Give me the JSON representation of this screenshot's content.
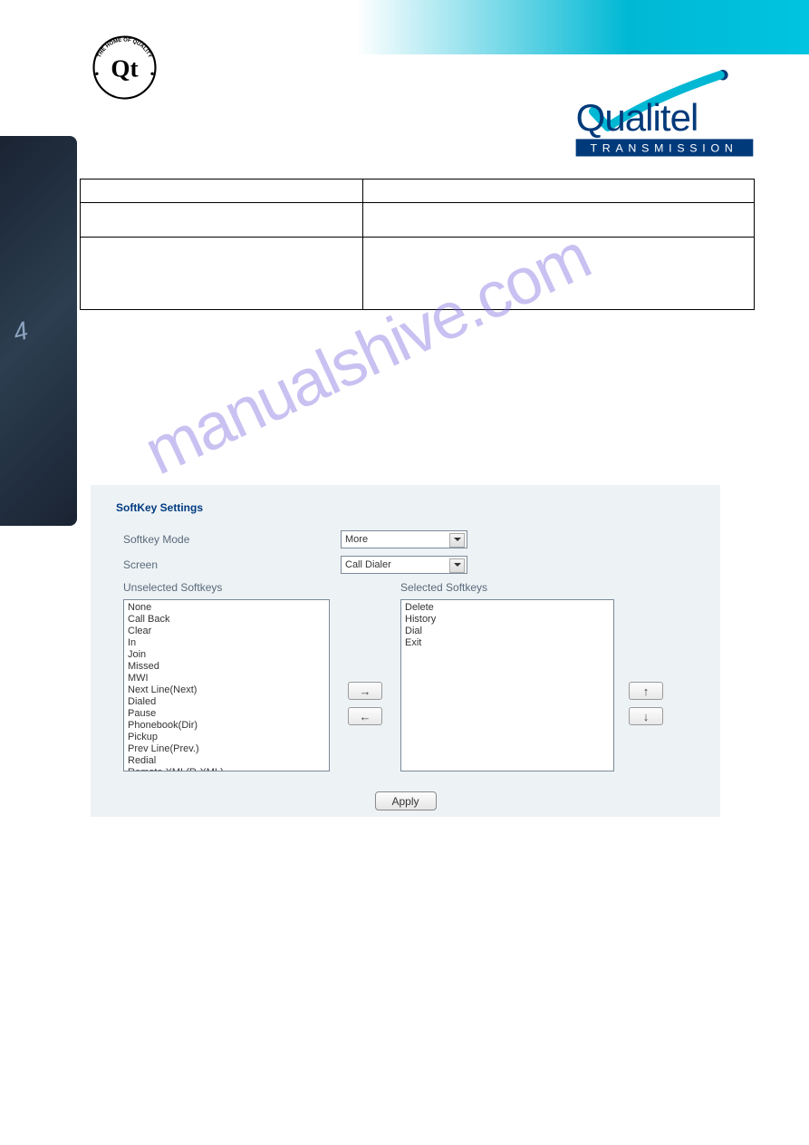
{
  "panel": {
    "title": "SoftKey Settings",
    "softkey_mode_label": "Softkey Mode",
    "softkey_mode_value": "More",
    "screen_label": "Screen",
    "screen_value": "Call Dialer",
    "unselected_label": "Unselected Softkeys",
    "selected_label": "Selected Softkeys",
    "unselected_items": [
      "None",
      "Call Back",
      "Clear",
      "In",
      "Join",
      "Missed",
      "MWI",
      "Next Line(Next)",
      "Dialed",
      "Pause",
      "Phonebook(Dir)",
      "Pickup",
      "Prev Line(Prev.)",
      "Redial",
      "Remote XML(R-XML)"
    ],
    "selected_items": [
      "Delete",
      "History",
      "Dial",
      "Exit"
    ],
    "move_right": "→",
    "move_left": "←",
    "move_up": "↑",
    "move_down": "↓",
    "apply": "Apply"
  },
  "watermark": "manualshive.com",
  "brand": {
    "seal_top": "THE HOME OF QUALITY",
    "seal_mark": "Qt",
    "name": "Qualitel",
    "tagline": "TRANSMISSION"
  }
}
